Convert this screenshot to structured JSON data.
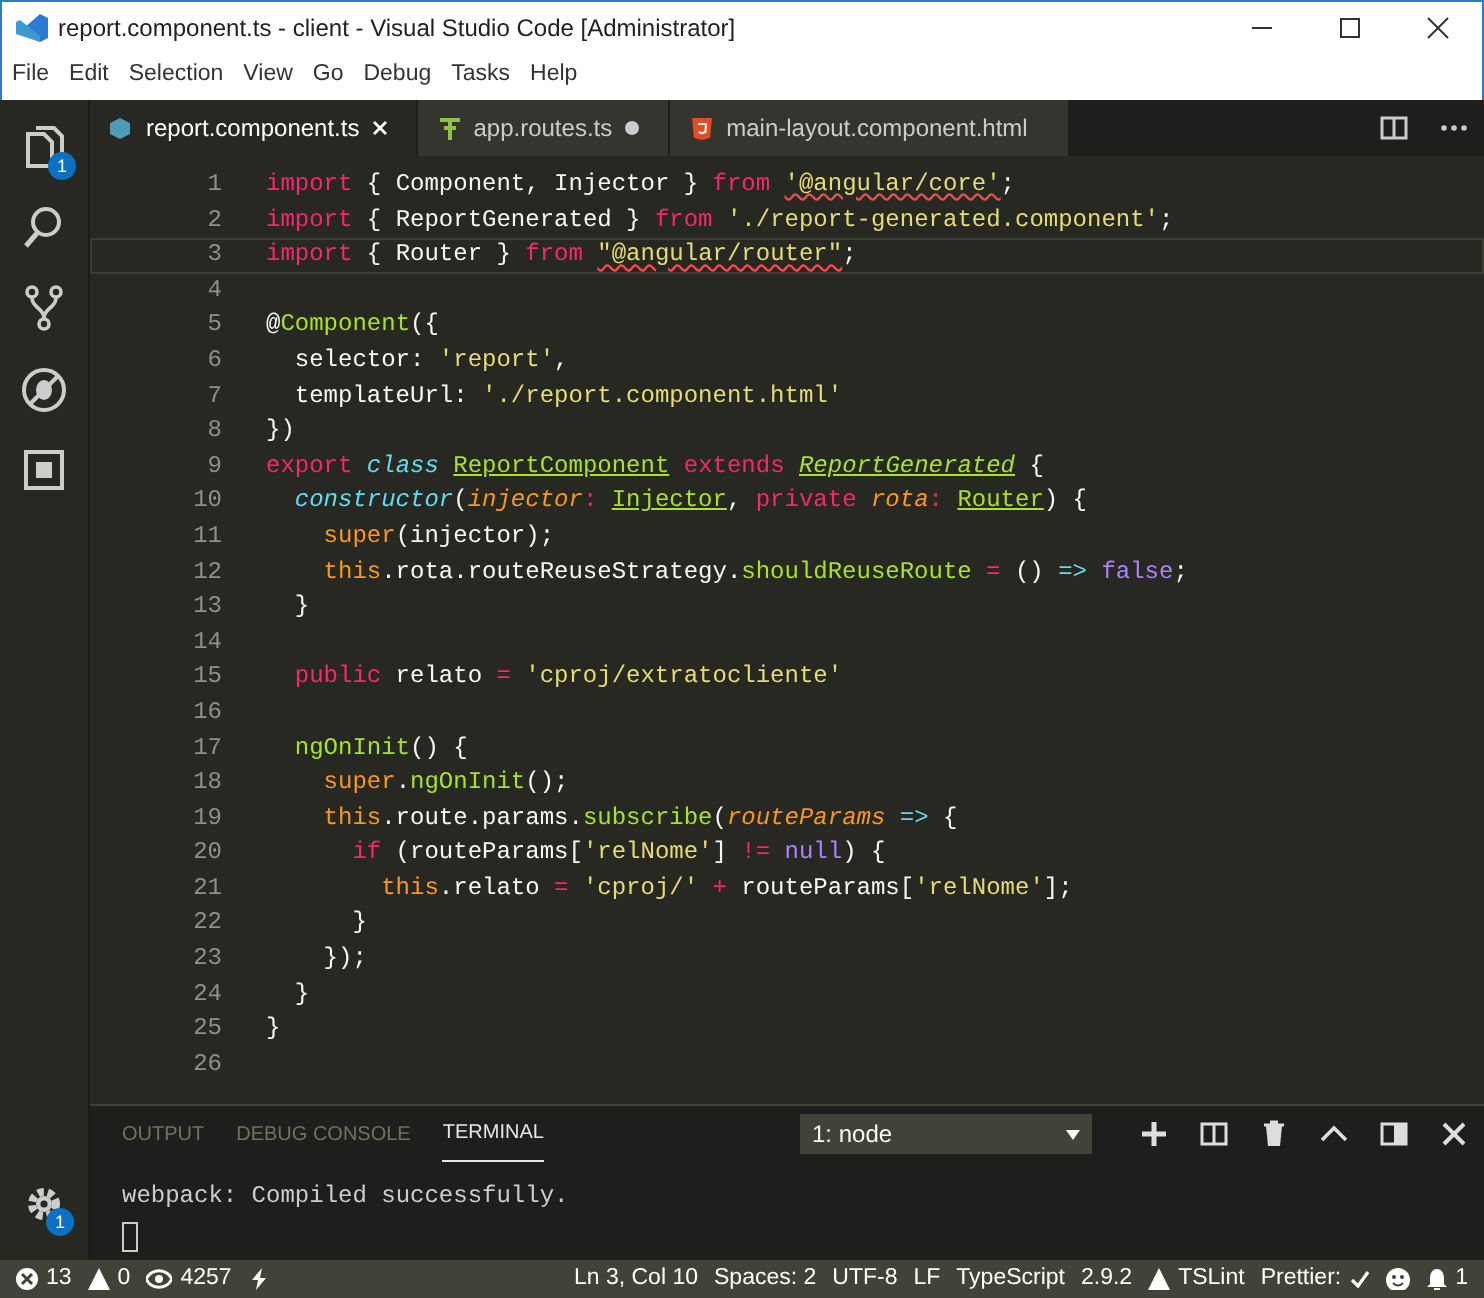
{
  "window": {
    "title": "report.component.ts - client - Visual Studio Code [Administrator]"
  },
  "menu": [
    "File",
    "Edit",
    "Selection",
    "View",
    "Go",
    "Debug",
    "Tasks",
    "Help"
  ],
  "activity_bar": [
    {
      "kind": "files",
      "badge": "1"
    },
    {
      "kind": "search"
    },
    {
      "kind": "git"
    },
    {
      "kind": "debug"
    },
    {
      "kind": "extensions"
    }
  ],
  "manage_badge": "1",
  "tabs": [
    {
      "label": "report.component.ts",
      "kind": "ts",
      "selected": true,
      "dirty": false
    },
    {
      "label": "app.routes.ts",
      "kind": "routes",
      "selected": false,
      "dirty": true
    },
    {
      "label": "main-layout.component.html",
      "kind": "html",
      "selected": false,
      "dirty": false
    }
  ],
  "editor": {
    "lines": [
      {
        "number": "1",
        "current": false,
        "tokens": [
          {
            "kind": "kw",
            "text": "import"
          },
          {
            "kind": "pl",
            "text": " { Component, Injector } "
          },
          {
            "kind": "kw",
            "text": "from "
          },
          {
            "kind": "err",
            "text": "'@angular/core'"
          },
          {
            "kind": "pl",
            "text": ";"
          }
        ]
      },
      {
        "number": "2",
        "current": false,
        "tokens": [
          {
            "kind": "kw",
            "text": "import"
          },
          {
            "kind": "pl",
            "text": " { ReportGenerated } "
          },
          {
            "kind": "kw",
            "text": "from "
          },
          {
            "kind": "st",
            "text": "'./report-generated.component'"
          },
          {
            "kind": "pl",
            "text": ";"
          }
        ]
      },
      {
        "number": "3",
        "current": true,
        "tokens": [
          {
            "kind": "kw",
            "text": "import"
          },
          {
            "kind": "pl",
            "text": " { Router } "
          },
          {
            "kind": "kw",
            "text": "from "
          },
          {
            "kind": "err",
            "text": "\"@angular/router\""
          },
          {
            "kind": "pl",
            "text": ";"
          }
        ]
      },
      {
        "number": "4",
        "current": false
      },
      {
        "number": "5",
        "current": false,
        "tokens": [
          {
            "kind": "pl",
            "text": "@"
          },
          {
            "kind": "fn",
            "text": "Component"
          },
          {
            "kind": "pl",
            "text": "({"
          }
        ]
      },
      {
        "number": "6",
        "current": false,
        "tokens": [
          {
            "kind": "pl",
            "text": "  selector: "
          },
          {
            "kind": "st",
            "text": "'report'"
          },
          {
            "kind": "pl",
            "text": ","
          }
        ]
      },
      {
        "number": "7",
        "current": false,
        "tokens": [
          {
            "kind": "pl",
            "text": "  templateUrl: "
          },
          {
            "kind": "st",
            "text": "'./report.component.html'"
          }
        ]
      },
      {
        "number": "8",
        "current": false,
        "tokens": [
          {
            "kind": "pl",
            "text": "})"
          }
        ]
      },
      {
        "number": "9",
        "current": false,
        "tokens": [
          {
            "kind": "kw",
            "text": "export "
          },
          {
            "kind": "it",
            "text": "class "
          },
          {
            "kind": "ty",
            "text": "ReportComponent"
          },
          {
            "kind": "kw",
            "text": " extends "
          },
          {
            "kind": "tyi",
            "text": "ReportGenerated"
          },
          {
            "kind": "pl",
            "text": " {"
          }
        ]
      },
      {
        "number": "10",
        "current": false,
        "tokens": [
          {
            "kind": "it",
            "text": "  constructor"
          },
          {
            "kind": "pl",
            "text": "("
          },
          {
            "kind": "pa",
            "text": "injector"
          },
          {
            "kind": "op",
            "text": ": "
          },
          {
            "kind": "ty",
            "text": "Injector"
          },
          {
            "kind": "pl",
            "text": ", "
          },
          {
            "kind": "kw",
            "text": "private "
          },
          {
            "kind": "pa",
            "text": "rota"
          },
          {
            "kind": "op",
            "text": ": "
          },
          {
            "kind": "ty",
            "text": "Router"
          },
          {
            "kind": "pl",
            "text": ") {"
          }
        ]
      },
      {
        "number": "11",
        "current": false,
        "tokens": [
          {
            "kind": "th",
            "text": "    super"
          },
          {
            "kind": "pl",
            "text": "(injector);"
          }
        ]
      },
      {
        "number": "12",
        "current": false,
        "tokens": [
          {
            "kind": "th",
            "text": "    this"
          },
          {
            "kind": "pl",
            "text": ".rota.routeReuseStrategy."
          },
          {
            "kind": "fn",
            "text": "shouldReuseRoute"
          },
          {
            "kind": "op",
            "text": " = "
          },
          {
            "kind": "pl",
            "text": "() "
          },
          {
            "kind": "it",
            "text": "=> "
          },
          {
            "kind": "nu",
            "text": "false"
          },
          {
            "kind": "pl",
            "text": ";"
          }
        ]
      },
      {
        "number": "13",
        "current": false,
        "tokens": [
          {
            "kind": "pl",
            "text": "  }"
          }
        ]
      },
      {
        "number": "14",
        "current": false
      },
      {
        "number": "15",
        "current": false,
        "tokens": [
          {
            "kind": "kw",
            "text": "  public"
          },
          {
            "kind": "pl",
            "text": " relato "
          },
          {
            "kind": "op",
            "text": "= "
          },
          {
            "kind": "st",
            "text": "'cproj/extratocliente'"
          }
        ]
      },
      {
        "number": "16",
        "current": false
      },
      {
        "number": "17",
        "current": false,
        "tokens": [
          {
            "kind": "fn",
            "text": "  ngOnInit"
          },
          {
            "kind": "pl",
            "text": "() {"
          }
        ]
      },
      {
        "number": "18",
        "current": false,
        "tokens": [
          {
            "kind": "th",
            "text": "    super"
          },
          {
            "kind": "pl",
            "text": "."
          },
          {
            "kind": "fn",
            "text": "ngOnInit"
          },
          {
            "kind": "pl",
            "text": "();"
          }
        ]
      },
      {
        "number": "19",
        "current": false,
        "tokens": [
          {
            "kind": "th",
            "text": "    this"
          },
          {
            "kind": "pl",
            "text": ".route.params."
          },
          {
            "kind": "fn",
            "text": "subscribe"
          },
          {
            "kind": "pl",
            "text": "("
          },
          {
            "kind": "pa",
            "text": "routeParams"
          },
          {
            "kind": "it",
            "text": " => "
          },
          {
            "kind": "pl",
            "text": "{"
          }
        ]
      },
      {
        "number": "20",
        "current": false,
        "tokens": [
          {
            "kind": "kw",
            "text": "      if"
          },
          {
            "kind": "pl",
            "text": " (routeParams["
          },
          {
            "kind": "st",
            "text": "'relNome'"
          },
          {
            "kind": "pl",
            "text": "] "
          },
          {
            "kind": "op",
            "text": "!= "
          },
          {
            "kind": "nu",
            "text": "null"
          },
          {
            "kind": "pl",
            "text": ") {"
          }
        ]
      },
      {
        "number": "21",
        "current": false,
        "tokens": [
          {
            "kind": "th",
            "text": "        this"
          },
          {
            "kind": "pl",
            "text": ".relato "
          },
          {
            "kind": "op",
            "text": "= "
          },
          {
            "kind": "st",
            "text": "'cproj/'"
          },
          {
            "kind": "op",
            "text": " + "
          },
          {
            "kind": "pl",
            "text": "routeParams["
          },
          {
            "kind": "st",
            "text": "'relNome'"
          },
          {
            "kind": "pl",
            "text": "];"
          }
        ]
      },
      {
        "number": "22",
        "current": false,
        "tokens": [
          {
            "kind": "pl",
            "text": "      }"
          }
        ]
      },
      {
        "number": "23",
        "current": false,
        "tokens": [
          {
            "kind": "pl",
            "text": "    });"
          }
        ]
      },
      {
        "number": "24",
        "current": false,
        "tokens": [
          {
            "kind": "pl",
            "text": "  }"
          }
        ]
      },
      {
        "number": "25",
        "current": false,
        "tokens": [
          {
            "kind": "pl",
            "text": "}"
          }
        ]
      },
      {
        "number": "26",
        "current": false
      }
    ]
  },
  "panel": {
    "tabs": [
      {
        "label": "OUTPUT",
        "selected": false
      },
      {
        "label": "DEBUG CONSOLE",
        "selected": false
      },
      {
        "label": "TERMINAL",
        "selected": true
      }
    ],
    "terminal_select": "1: node",
    "actions": [
      {
        "kind": "plus"
      },
      {
        "kind": "split"
      },
      {
        "kind": "trash"
      },
      {
        "kind": "up"
      },
      {
        "kind": "maximize"
      },
      {
        "kind": "close"
      }
    ],
    "output": [
      "webpack: Compiled successfully."
    ]
  },
  "status_bar": {
    "errors": "13",
    "warnings": "0",
    "watch": "4257",
    "right": [
      {
        "kind": "text",
        "label": "Ln 3, Col 10"
      },
      {
        "kind": "text",
        "label": "Spaces: 2"
      },
      {
        "kind": "text",
        "label": "UTF-8"
      },
      {
        "kind": "text",
        "label": "LF"
      },
      {
        "kind": "text",
        "label": "TypeScript"
      },
      {
        "kind": "text",
        "label": "2.9.2"
      },
      {
        "kind": "warn",
        "label": "TSLint"
      },
      {
        "kind": "check",
        "label": "Prettier:"
      },
      {
        "kind": "smiley"
      },
      {
        "kind": "bell",
        "label": "1"
      }
    ]
  }
}
